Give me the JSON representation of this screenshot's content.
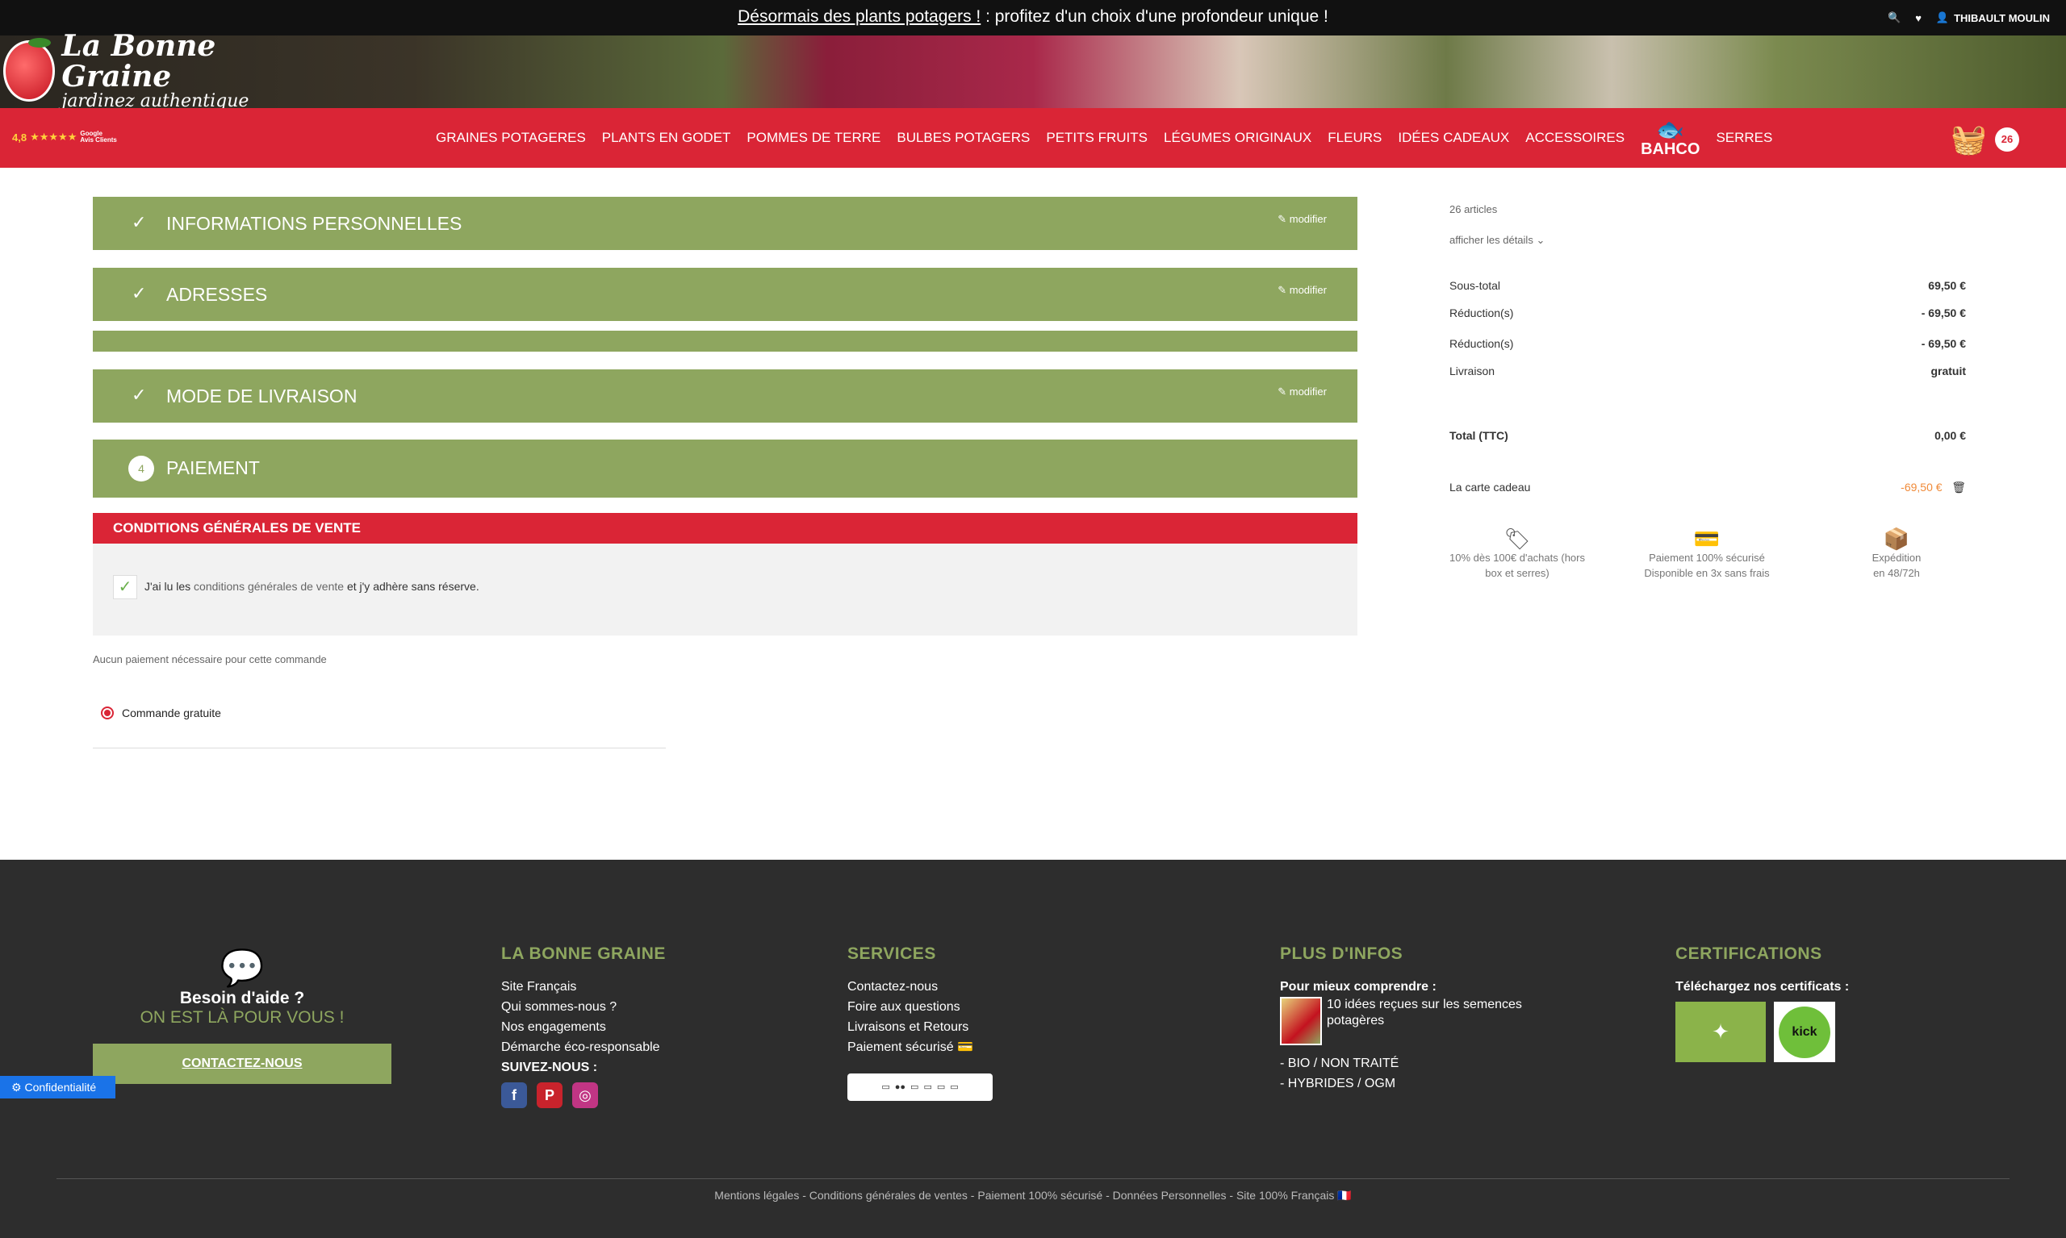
{
  "topbar": {
    "promo_link": "Désormais des plants potagers !",
    "promo_rest": " : profitez d'un choix d'une profondeur unique !",
    "user_name": "THIBAULT MOULIN",
    "icons": [
      "search-icon",
      "heart-icon",
      "user-icon"
    ]
  },
  "logo": {
    "line1": "La Bonne Graine",
    "line2": "jardinez authentique"
  },
  "rating": {
    "score": "4,8",
    "stars": "★★★★★",
    "source_line1": "Google",
    "source_line2": "Avis Clients"
  },
  "nav": {
    "items": [
      "GRAINES POTAGERES",
      "PLANTS EN GODET",
      "POMMES DE TERRE",
      "BULBES POTAGERS",
      "PETITS FRUITS",
      "LÉGUMES ORIGINAUX",
      "FLEURS",
      "IDÉES CADEAUX",
      "ACCESSOIRES"
    ],
    "bahco": "BAHCO",
    "last_item": "SERRES",
    "cart_count": "26"
  },
  "steps": {
    "s1": {
      "title": "INFORMATIONS PERSONNELLES",
      "edit": "modifier"
    },
    "s2": {
      "title": "ADRESSES",
      "edit": "modifier"
    },
    "s3": {
      "title": "MODE DE LIVRAISON",
      "edit": "modifier"
    },
    "s4": {
      "num": "4",
      "title": "PAIEMENT"
    }
  },
  "cgv": {
    "heading": "CONDITIONS GÉNÉRALES DE VENTE",
    "text_before": "J'ai lu les ",
    "link": "conditions générales de vente",
    "text_after": " et j'y adhère sans réserve."
  },
  "payment": {
    "no_payment": "Aucun paiement nécessaire pour cette commande",
    "option": "Commande gratuite"
  },
  "summary": {
    "articles": "26 articles",
    "show_details": "afficher les détails",
    "subtotal_label": "Sous-total",
    "subtotal": "69,50 €",
    "reduction_label": "Réduction(s)",
    "reduction1": "- 69,50 €",
    "reduction2": "- 69,50 €",
    "shipping_label": "Livraison",
    "shipping": "gratuit",
    "total_label": "Total (TTC)",
    "total": "0,00 €",
    "giftcard_label": "La carte cadeau",
    "giftcard": "-69,50 €"
  },
  "reassurance": [
    {
      "icon": "tag-icon",
      "line1": "10% dès 100€ d'achats (hors",
      "line2": "box et serres)"
    },
    {
      "icon": "credit-card-icon",
      "line1": "Paiement 100% sécurisé",
      "line2": "Disponible en 3x sans frais"
    },
    {
      "icon": "delivery-icon",
      "line1": "Expédition",
      "line2": "en 48/72h"
    }
  ],
  "footer": {
    "help_title": "Besoin d'aide ?",
    "help_subtitle": "ON EST LÀ POUR VOUS !",
    "help_button": "CONTACTEZ-NOUS",
    "col1": {
      "title": "LA BONNE GRAINE",
      "links": [
        "Site Français",
        "Qui sommes-nous ?",
        "Nos engagements",
        "Démarche éco-responsable"
      ],
      "follow": "SUIVEZ-NOUS :"
    },
    "col2": {
      "title": "SERVICES",
      "links": [
        "Contactez-nous",
        "Foire aux questions",
        "Livraisons et Retours",
        "Paiement sécurisé"
      ]
    },
    "col3": {
      "title": "PLUS D'INFOS",
      "subtitle": "Pour mieux comprendre :",
      "article": "10 idées reçues sur les semences potagères",
      "links": [
        "- BIO / NON TRAITÉ",
        "- HYBRIDES / OGM"
      ]
    },
    "col4": {
      "title": "CERTIFICATIONS",
      "subtitle": "Téléchargez nos certificats :"
    },
    "legal": "Mentions légales - Conditions générales de ventes - Paiement 100% sécurisé - Données Personnelles - Site 100% Français",
    "privacy": "Confidentialité"
  }
}
